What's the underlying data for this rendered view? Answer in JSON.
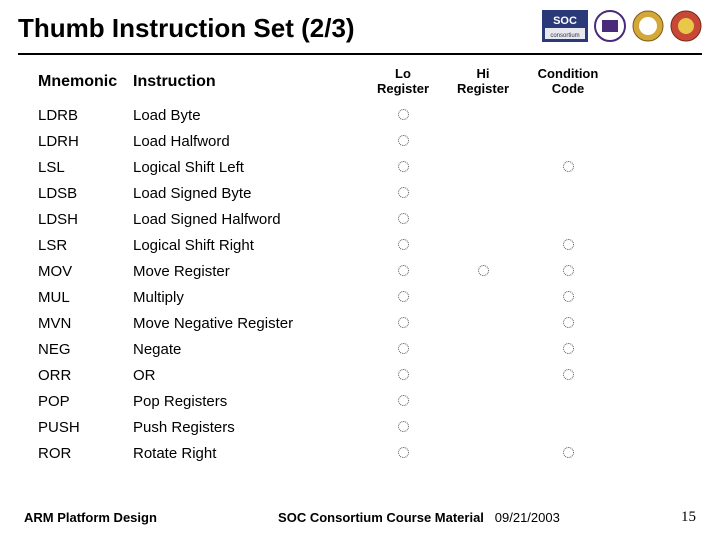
{
  "title": "Thumb Instruction Set (2/3)",
  "columns": {
    "mnemonic": "Mnemonic",
    "instruction": "Instruction",
    "lo": "Lo\nRegister",
    "hi": "Hi\nRegister",
    "cc": "Condition\nCode"
  },
  "rows": [
    {
      "mnemonic": "LDRB",
      "instruction": "Load Byte",
      "lo": true,
      "hi": false,
      "cc": false
    },
    {
      "mnemonic": "LDRH",
      "instruction": "Load Halfword",
      "lo": true,
      "hi": false,
      "cc": false
    },
    {
      "mnemonic": "LSL",
      "instruction": "Logical Shift Left",
      "lo": true,
      "hi": false,
      "cc": true
    },
    {
      "mnemonic": "LDSB",
      "instruction": "Load Signed Byte",
      "lo": true,
      "hi": false,
      "cc": false
    },
    {
      "mnemonic": "LDSH",
      "instruction": "Load Signed Halfword",
      "lo": true,
      "hi": false,
      "cc": false
    },
    {
      "mnemonic": "LSR",
      "instruction": "Logical Shift Right",
      "lo": true,
      "hi": false,
      "cc": true
    },
    {
      "mnemonic": "MOV",
      "instruction": "Move Register",
      "lo": true,
      "hi": true,
      "cc": true
    },
    {
      "mnemonic": "MUL",
      "instruction": "Multiply",
      "lo": true,
      "hi": false,
      "cc": true
    },
    {
      "mnemonic": "MVN",
      "instruction": "Move Negative Register",
      "lo": true,
      "hi": false,
      "cc": true
    },
    {
      "mnemonic": "NEG",
      "instruction": "Negate",
      "lo": true,
      "hi": false,
      "cc": true
    },
    {
      "mnemonic": "ORR",
      "instruction": "OR",
      "lo": true,
      "hi": false,
      "cc": true
    },
    {
      "mnemonic": "POP",
      "instruction": "Pop Registers",
      "lo": true,
      "hi": false,
      "cc": false
    },
    {
      "mnemonic": "PUSH",
      "instruction": "Push Registers",
      "lo": true,
      "hi": false,
      "cc": false
    },
    {
      "mnemonic": "ROR",
      "instruction": "Rotate Right",
      "lo": true,
      "hi": false,
      "cc": true
    }
  ],
  "footer": {
    "left": "ARM Platform Design",
    "mid_bold": "SOC Consortium Course Material",
    "mid_date": "09/21/2003",
    "page": "15"
  }
}
